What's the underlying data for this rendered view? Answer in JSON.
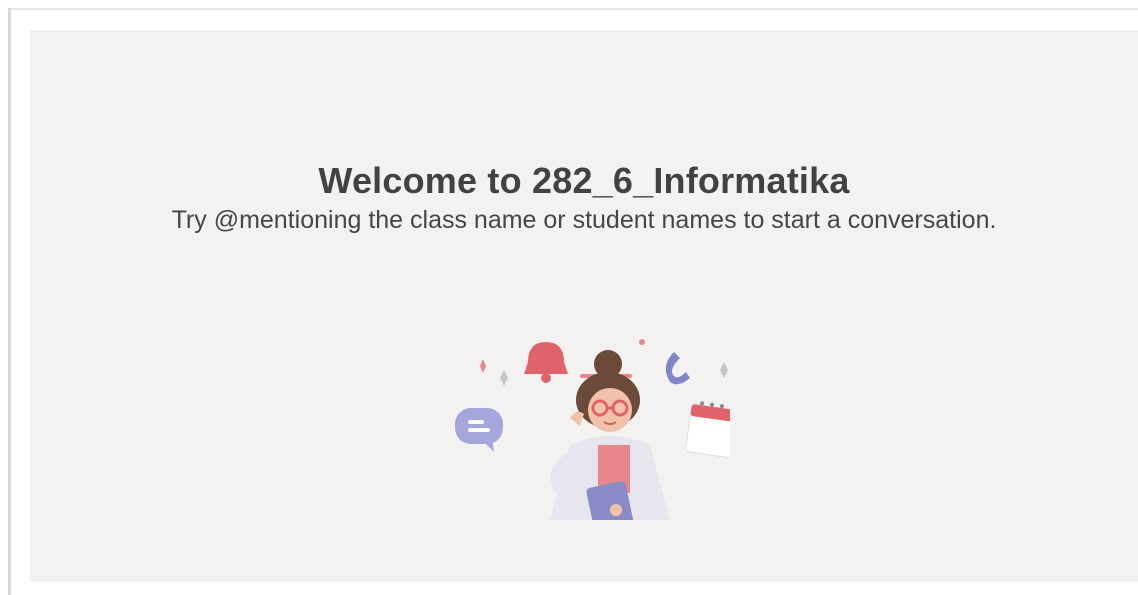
{
  "welcome": {
    "title": "Welcome to 282_6_Informatika",
    "subtitle": "Try @mentioning the class name or student names to start a conversation."
  },
  "illustration": {
    "icons": [
      "chat-bubble-icon",
      "bell-icon",
      "phone-icon",
      "calendar-icon",
      "sparkle-icon",
      "teacher-figure"
    ]
  },
  "colors": {
    "panel_bg": "#f3f2f1",
    "title_text": "#424242",
    "accent_purple": "#8b8cc7",
    "accent_pink": "#e8868c",
    "accent_red": "#e0636b"
  }
}
